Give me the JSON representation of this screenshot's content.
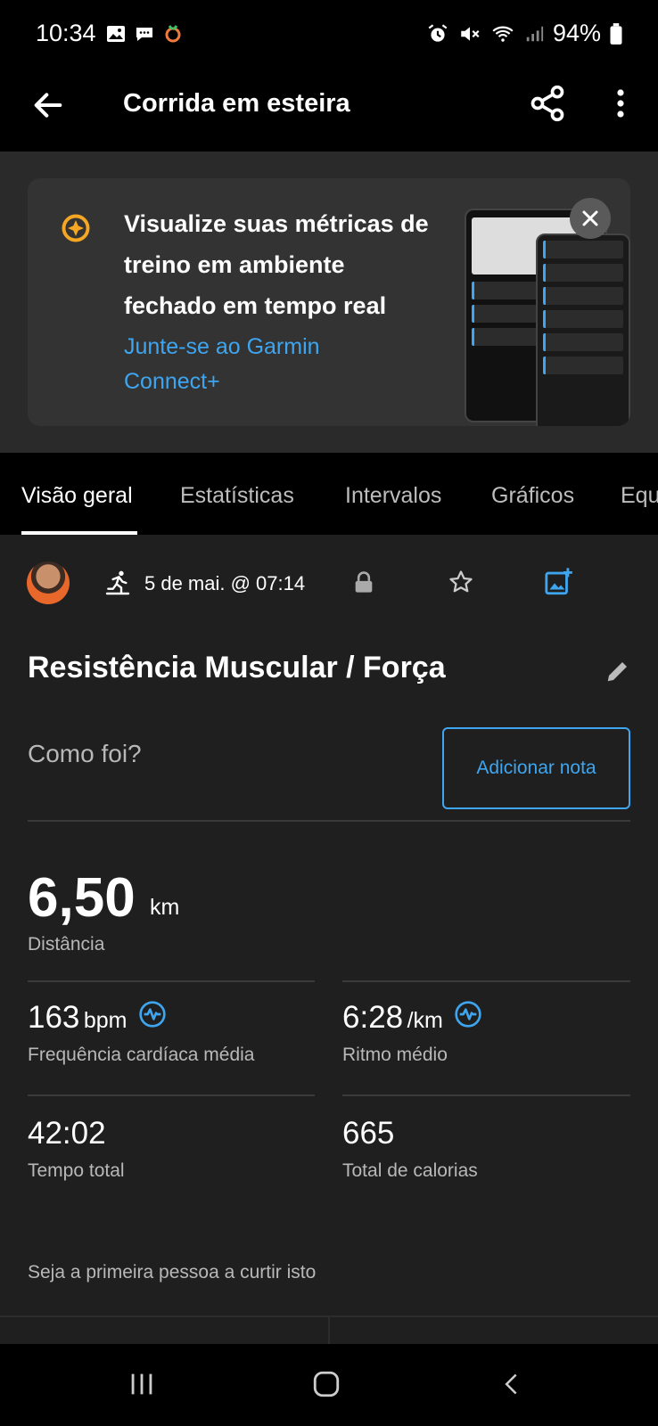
{
  "status_bar": {
    "time": "10:34",
    "battery": "94%",
    "left_icons": [
      "gallery-icon",
      "chat-icon",
      "garmin-icon"
    ],
    "right_icons": [
      "alarm-icon",
      "mute-icon",
      "wifi-icon",
      "signal-icon",
      "battery-icon"
    ]
  },
  "app_bar": {
    "title": "Corrida em esteira",
    "back_icon": "arrow-left-icon",
    "share_icon": "share-icon",
    "more_icon": "more-vert-icon"
  },
  "promo": {
    "headline": "Visualize suas métricas de treino em ambiente fechado em tempo real",
    "cta": "Junte-se ao Garmin Connect+",
    "close_icon": "close-icon"
  },
  "tabs": [
    {
      "label": "Visão geral",
      "active": true
    },
    {
      "label": "Estatísticas",
      "active": false
    },
    {
      "label": "Intervalos",
      "active": false
    },
    {
      "label": "Gráficos",
      "active": false
    },
    {
      "label": "Equ",
      "active": false
    }
  ],
  "activity": {
    "datetime": "5 de mai. @ 07:14",
    "name": "Resistência Muscular / Força",
    "how_was": "Como foi?",
    "add_note": "Adicionar nota"
  },
  "stats": {
    "distance": {
      "value": "6,50",
      "unit": "km",
      "label": "Distância"
    },
    "heart_rate": {
      "value": "163",
      "unit": "bpm",
      "label": "Frequência cardíaca média"
    },
    "pace": {
      "value": "6:28",
      "unit": "/km",
      "label": "Ritmo médio"
    },
    "time": {
      "value": "42:02",
      "label": "Tempo total"
    },
    "calories": {
      "value": "665",
      "label": "Total de calorias"
    }
  },
  "likes_text": "Seja a primeira pessoa a curtir isto",
  "colors": {
    "accent": "#3ea6f0",
    "background": "#1f1f1f",
    "bar": "#000000",
    "garmin_gold": "#f5a623"
  }
}
